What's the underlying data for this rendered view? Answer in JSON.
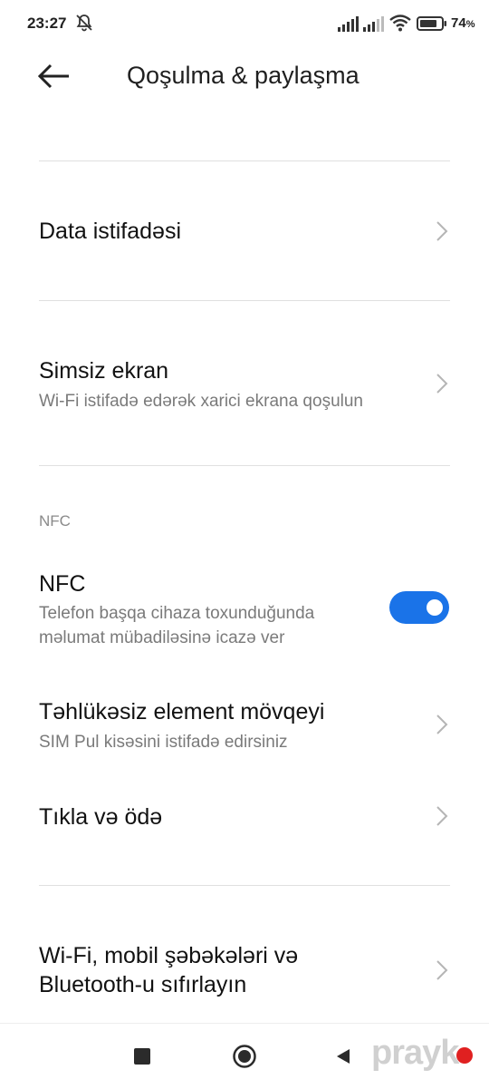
{
  "status_bar": {
    "time": "23:27",
    "battery": "74",
    "battery_unit": "%"
  },
  "header": {
    "title": "Qoşulma & paylaşma"
  },
  "items": {
    "data_usage": {
      "title": "Data istifadəsi"
    },
    "wireless_display": {
      "title": "Simsiz ekran",
      "subtitle": "Wi-Fi istifadə edərək xarici ekrana qoşulun"
    },
    "nfc_section_label": "NFC",
    "nfc": {
      "title": "NFC",
      "subtitle_line1": "Telefon başqa cihaza toxunduğunda",
      "subtitle_line2": "məlumat mübadiləsinə icazə ver",
      "enabled": true
    },
    "secure_element": {
      "title": "Təhlükəsiz element mövqeyi",
      "subtitle": "SIM Pul kisəsini istifadə edirsiniz"
    },
    "tap_pay": {
      "title": "Tıkla və ödə"
    },
    "reset_network": {
      "title_line1": "Wi-Fi, mobil şəbəkələri və",
      "title_line2": "Bluetooth-u sıfırlayın"
    }
  },
  "watermark": "prayk",
  "colors": {
    "accent": "#1a73e8",
    "divider": "#e0e0e0",
    "subtitle": "#7a7a7a"
  }
}
